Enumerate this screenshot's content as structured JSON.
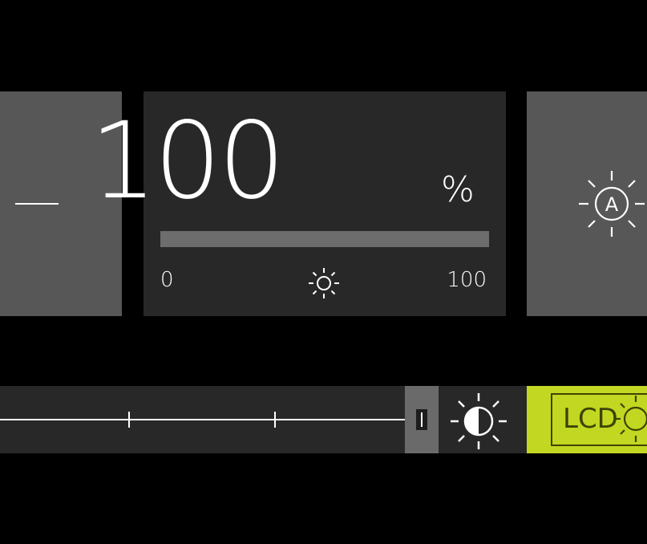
{
  "brightness": {
    "value": "100",
    "unit": "%",
    "level_fraction": 1.0,
    "scale_min": "0",
    "scale_max": "100",
    "icon": "sun-icon"
  },
  "controls": {
    "decrease_icon": "minus-icon",
    "auto_icon": "auto-brightness-icon"
  },
  "bottom_bar": {
    "slider_ticks": 2,
    "contrast_icon": "contrast-icon",
    "lcd_label": "LCD",
    "lcd_icon": "lcd-backlight-icon"
  },
  "colors": {
    "background": "#000000",
    "panel": "#282828",
    "side_panel": "#575757",
    "accent": "#c2d721",
    "accent_text": "#3c4405"
  }
}
